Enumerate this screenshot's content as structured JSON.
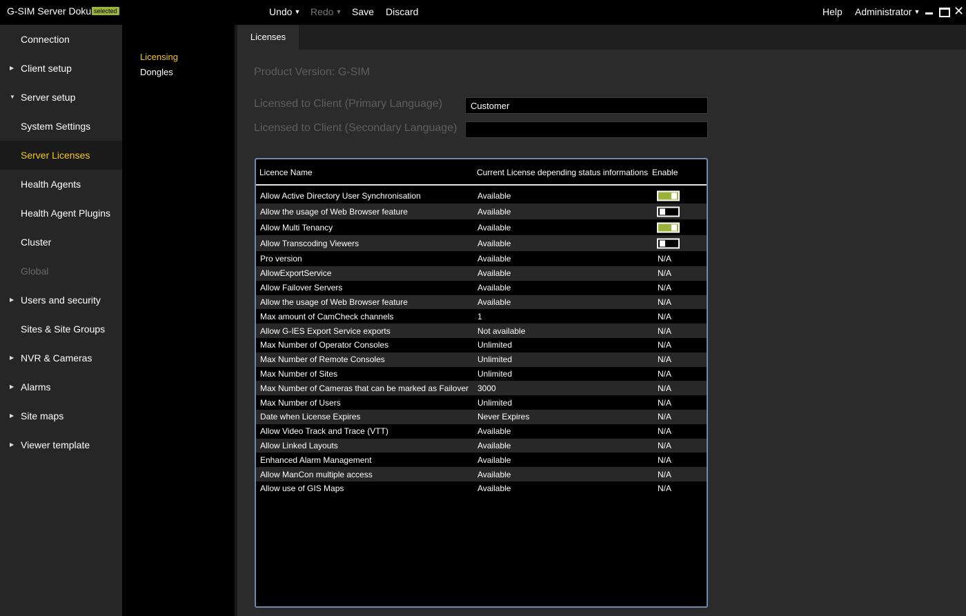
{
  "app": {
    "title": "G-SIM Server Doku",
    "badge": "selected"
  },
  "toolbar": {
    "undo": "Undo",
    "redo": "Redo",
    "save": "Save",
    "discard": "Discard",
    "help": "Help",
    "user": "Administrator",
    "close_glyph": "✕"
  },
  "nav": [
    {
      "label": "Connection",
      "arrow": ""
    },
    {
      "label": "Client setup",
      "arrow": "▶"
    },
    {
      "label": "Server setup",
      "arrow": "▼"
    },
    {
      "label": "System Settings",
      "arrow": ""
    },
    {
      "label": "Server Licenses",
      "arrow": "",
      "active": true
    },
    {
      "label": "Health Agents",
      "arrow": ""
    },
    {
      "label": "Health Agent Plugins",
      "arrow": ""
    },
    {
      "label": "Cluster",
      "arrow": ""
    },
    {
      "label": "Global",
      "arrow": "",
      "disabled": true
    },
    {
      "label": "Users and security",
      "arrow": "▶"
    },
    {
      "label": "Sites & Site Groups",
      "arrow": ""
    },
    {
      "label": "NVR & Cameras",
      "arrow": "▶"
    },
    {
      "label": "Alarms",
      "arrow": "▶"
    },
    {
      "label": "Site maps",
      "arrow": "▶"
    },
    {
      "label": "Viewer template",
      "arrow": "▶"
    }
  ],
  "subnav": [
    {
      "label": "Licensing",
      "active": true
    },
    {
      "label": "Dongles"
    }
  ],
  "tab": "Licenses",
  "form": {
    "product_version": "Product Version: G-SIM",
    "primary_label": "Licensed to Client (Primary Language)",
    "primary_value": "Customer",
    "secondary_label": "Licensed to Client (Secondary Language)",
    "secondary_value": ""
  },
  "table": {
    "headers": {
      "name": "Licence Name",
      "status": "Current License depending status informations",
      "enable": "Enable"
    },
    "rows": [
      {
        "name": "Allow Active Directory User Synchronisation",
        "status": "Available",
        "toggle": true
      },
      {
        "name": "Allow the usage of Web Browser feature",
        "status": "Available",
        "toggle": false
      },
      {
        "name": "Allow Multi Tenancy",
        "status": "Available",
        "toggle": true
      },
      {
        "name": "Allow Transcoding Viewers",
        "status": "Available",
        "toggle": false
      },
      {
        "name": "Pro version",
        "status": "Available",
        "enable": "N/A"
      },
      {
        "name": "AllowExportService",
        "status": "Available",
        "enable": "N/A"
      },
      {
        "name": "Allow Failover Servers",
        "status": "Available",
        "enable": "N/A"
      },
      {
        "name": "Allow the usage of Web Browser feature",
        "status": "Available",
        "enable": "N/A"
      },
      {
        "name": "Max amount of CamCheck channels",
        "status": "1",
        "enable": "N/A"
      },
      {
        "name": "Allow G-IES Export Service exports",
        "status": "Not available",
        "enable": "N/A"
      },
      {
        "name": "Max Number of Operator Consoles",
        "status": "Unlimited",
        "enable": "N/A"
      },
      {
        "name": "Max Number of Remote Consoles",
        "status": "Unlimited",
        "enable": "N/A"
      },
      {
        "name": "Max Number of Sites",
        "status": "Unlimited",
        "enable": "N/A"
      },
      {
        "name": "Max Number of Cameras that can be marked as Failover",
        "status": "3000",
        "enable": "N/A"
      },
      {
        "name": "Max Number of Users",
        "status": "Unlimited",
        "enable": "N/A"
      },
      {
        "name": "Date when License Expires",
        "status": "Never Expires",
        "enable": "N/A"
      },
      {
        "name": "Allow Video Track and Trace (VTT)",
        "status": "Available",
        "enable": "N/A"
      },
      {
        "name": "Allow Linked Layouts",
        "status": "Available",
        "enable": "N/A"
      },
      {
        "name": "Enhanced Alarm Management",
        "status": "Available",
        "enable": "N/A"
      },
      {
        "name": "Allow ManCon multiple access",
        "status": "Available",
        "enable": "N/A"
      },
      {
        "name": "Allow use of GIS Maps",
        "status": "Available",
        "enable": "N/A"
      }
    ]
  },
  "colors": {
    "accent": "#f5c518",
    "toggle_on": "#9ab33a",
    "table_border": "#6b8bb0"
  }
}
